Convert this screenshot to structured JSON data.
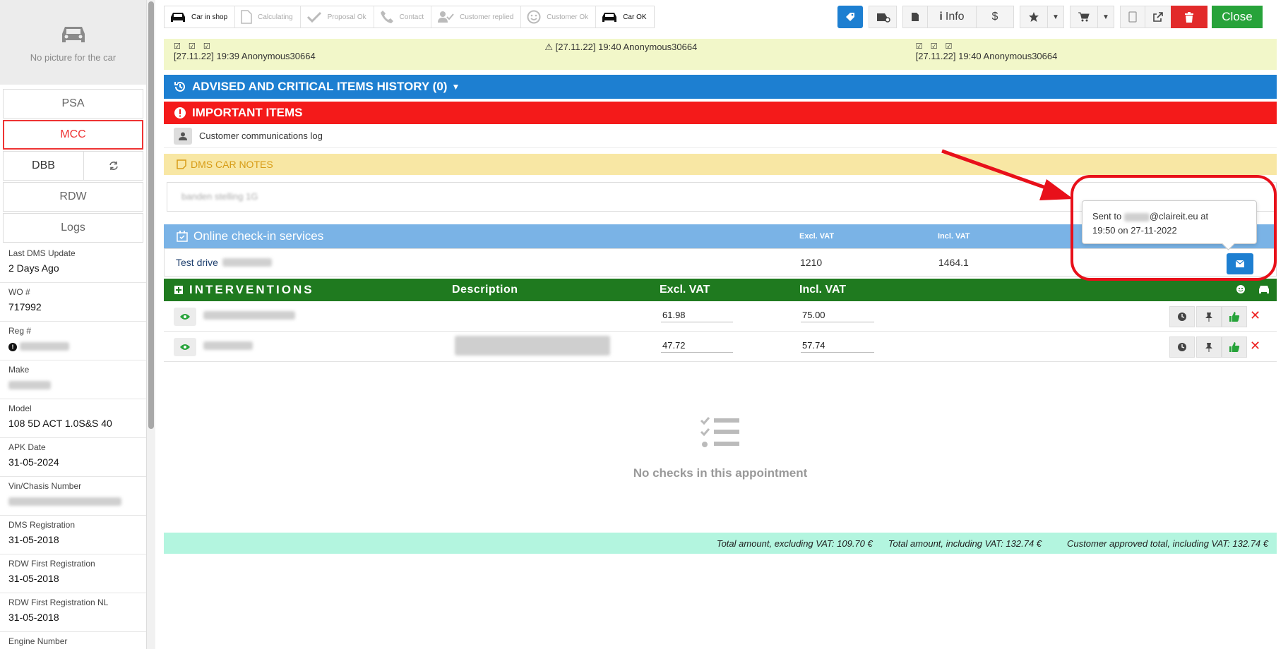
{
  "sidebar": {
    "no_picture": "No picture for the car",
    "buttons": [
      "PSA",
      "MCC"
    ],
    "dbb": "DBB",
    "rdw": "RDW",
    "logs": "Logs",
    "info": [
      {
        "label": "Last DMS Update",
        "value": "2 Days Ago"
      },
      {
        "label": "WO #",
        "value": "717992"
      },
      {
        "label": "Reg #",
        "value": ""
      },
      {
        "label": "Make",
        "value": ""
      },
      {
        "label": "Model",
        "value": "108 5D ACT 1.0S&S 40"
      },
      {
        "label": "APK Date",
        "value": "31-05-2024"
      },
      {
        "label": "Vin/Chasis Number",
        "value": ""
      },
      {
        "label": "DMS Registration",
        "value": "31-05-2018"
      },
      {
        "label": "RDW First Registration",
        "value": "31-05-2018"
      },
      {
        "label": "RDW First Registration NL",
        "value": "31-05-2018"
      },
      {
        "label": "Engine Number",
        "value": ""
      }
    ]
  },
  "status_steps": [
    {
      "label": "Car in shop",
      "icon": "car-icon",
      "active": true
    },
    {
      "label": "Calculating",
      "icon": "document-icon",
      "active": false
    },
    {
      "label": "Proposal Ok",
      "icon": "check-icon",
      "active": false
    },
    {
      "label": "Contact",
      "icon": "phone-icon",
      "active": false
    },
    {
      "label": "Customer replied",
      "icon": "user-check-icon",
      "active": false
    },
    {
      "label": "Customer Ok",
      "icon": "smile-icon",
      "active": false
    },
    {
      "label": "Car OK",
      "icon": "car-icon",
      "active": true
    }
  ],
  "toolbar": {
    "info": "Info",
    "dollar": "$",
    "close": "Close"
  },
  "logs": [
    {
      "checks": "☑ ☑ ☑",
      "text": "[27.11.22] 19:39 Anonymous30664"
    },
    {
      "checks": "⚠",
      "text": "[27.11.22] 19:40 Anonymous30664"
    },
    {
      "checks": "☑ ☑ ☑",
      "text": "[27.11.22] 19:40 Anonymous30664"
    }
  ],
  "history_bar": "ADVISED AND CRITICAL ITEMS HISTORY (0)",
  "important_bar": "IMPORTANT ITEMS",
  "comm_log": "Customer communications log",
  "dms_notes": {
    "title": "DMS CAR NOTES",
    "text": "banden stelling 1G"
  },
  "checkin": {
    "title": "Online check-in services",
    "excl_hdr": "Excl. VAT",
    "incl_hdr": "Incl. VAT",
    "row": {
      "name": "Test drive",
      "excl": "1210",
      "incl": "1464.1"
    }
  },
  "interventions": {
    "title": "INTERVENTIONS",
    "desc_hdr": "Description",
    "excl_hdr": "Excl. VAT",
    "incl_hdr": "Incl. VAT",
    "rows": [
      {
        "excl": "61.98",
        "incl": "75.00"
      },
      {
        "excl": "47.72",
        "incl": "57.74"
      }
    ]
  },
  "empty_state": "No checks in this appointment",
  "totals": {
    "excl": "Total amount, excluding VAT: 109.70 €",
    "incl": "Total amount, including VAT: 132.74 €",
    "approved": "Customer approved total, including VAT: 132.74 €"
  },
  "tooltip": {
    "prefix": "Sent to",
    "suffix": "@claireit.eu at",
    "line2": "19:50 on 27-11-2022"
  }
}
